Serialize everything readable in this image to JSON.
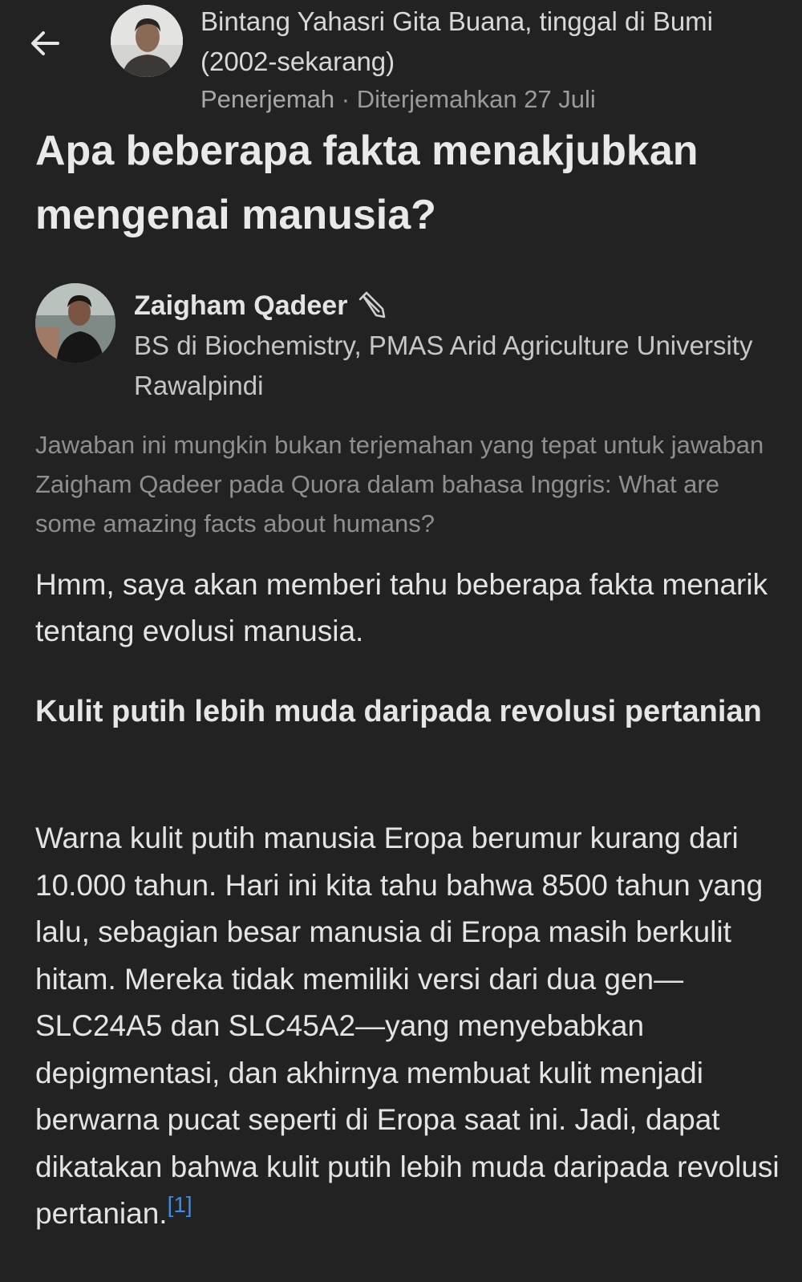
{
  "header": {
    "back_icon": "arrow-left-icon",
    "translator": {
      "name": "Bintang Yahasri Gita Buana, tinggal di Bumi (2002-sekarang)",
      "role": "Penerjemah",
      "separator": " · ",
      "translated_date": "Diterjemahkan 27 Juli"
    }
  },
  "question": {
    "title": "Apa beberapa fakta menakjubkan mengenai manusia?"
  },
  "author": {
    "name": "Zaigham Qadeer",
    "badge_icon": "pen-icon",
    "credential": "BS di Biochemistry, PMAS Arid Agriculture University Rawalpindi"
  },
  "notice": {
    "text": "Jawaban ini mungkin bukan terjemahan yang tepat untuk jawaban Zaigham Qadeer pada Quora dalam bahasa Inggris: ",
    "link": "What are some amazing facts about humans?"
  },
  "answer": {
    "intro": "Hmm, saya akan memberi tahu beberapa fakta menarik tentang evolusi manusia.",
    "heading": "Kulit putih lebih muda daripada revolusi pertanian",
    "paragraph": "Warna kulit putih manusia Eropa berumur kurang dari 10.000 tahun. Hari ini kita tahu bahwa 8500 tahun yang lalu, sebagian besar manusia di Eropa masih berkulit hitam. Mereka tidak memiliki versi dari dua gen—SLC24A5 dan SLC45A2—yang menyebabkan depigmentasi, dan akhirnya membuat kulit menjadi berwarna pucat seperti di Eropa saat ini. Jadi, dapat dikatakan bahwa kulit putih lebih muda daripada revolusi pertanian.",
    "footnote": "[1]"
  },
  "colors": {
    "background": "#222222",
    "footnote_link": "#3b8ee8"
  }
}
